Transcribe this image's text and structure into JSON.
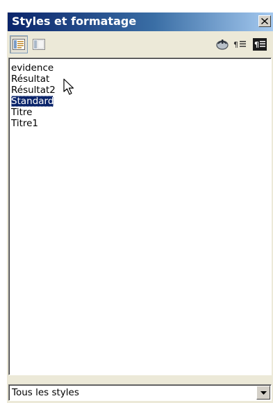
{
  "window": {
    "title": "Styles et formatage"
  },
  "toolbar": {
    "buttons": [
      {
        "name": "paragraph-styles",
        "icon": "paragraph-styles-icon",
        "pressed": true
      },
      {
        "name": "character-styles",
        "icon": "character-styles-icon",
        "pressed": false
      },
      {
        "name": "fill-format-mode",
        "icon": "fill-format-icon",
        "pressed": false
      },
      {
        "name": "new-style-from-selection",
        "icon": "new-style-icon",
        "pressed": false
      },
      {
        "name": "update-style",
        "icon": "update-style-icon",
        "pressed": false
      }
    ]
  },
  "styles_list": {
    "items": [
      "evidence",
      "Résultat",
      "Résultat2",
      "Standard",
      "Titre",
      "Titre1"
    ],
    "selected": "Standard"
  },
  "filter": {
    "value": "Tous les styles"
  },
  "colors": {
    "titlebar_start": "#0a246a",
    "titlebar_end": "#a6caf0",
    "selection": "#0a246a",
    "window_bg": "#ece9d8"
  }
}
